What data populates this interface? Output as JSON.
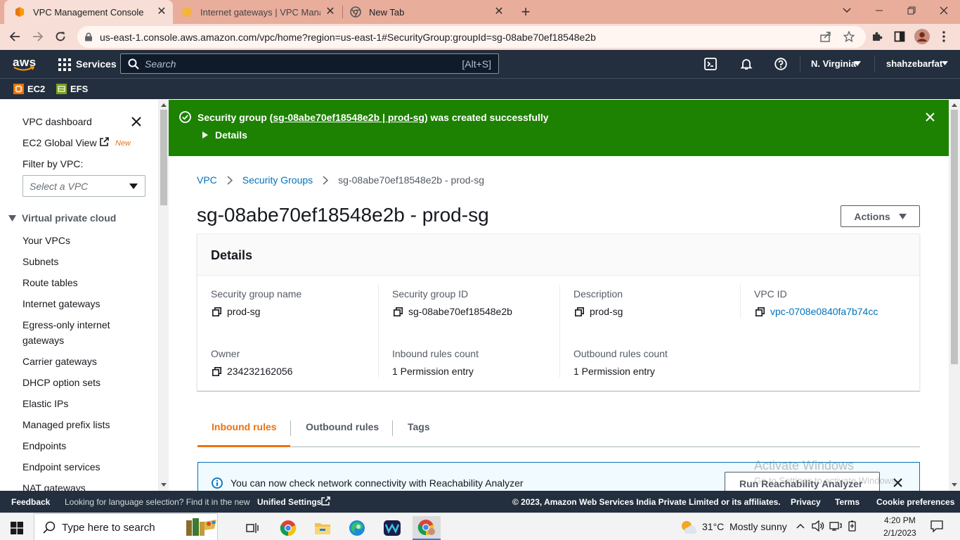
{
  "browser": {
    "tabs": [
      {
        "title": "VPC Management Console",
        "active": true
      },
      {
        "title": "Internet gateways | VPC Managem",
        "active": false
      },
      {
        "title": "New Tab",
        "active": false
      }
    ],
    "url": "us-east-1.console.aws.amazon.com/vpc/home?region=us-east-1#SecurityGroup:groupId=sg-08abe70ef18548e2b"
  },
  "aws_header": {
    "logo": "aws",
    "services_label": "Services",
    "search_placeholder": "Search",
    "search_shortcut": "[Alt+S]",
    "region": "N. Virginia",
    "user": "shahzebarfat",
    "favorites": [
      {
        "label": "EC2",
        "color": "#ed7100"
      },
      {
        "label": "EFS",
        "color": "#7aa116"
      }
    ]
  },
  "sidebar": {
    "top_items": [
      "VPC dashboard",
      "EC2 Global View"
    ],
    "new_badge": "New",
    "filter_label": "Filter by VPC:",
    "filter_placeholder": "Select a VPC",
    "section_title": "Virtual private cloud",
    "items": [
      "Your VPCs",
      "Subnets",
      "Route tables",
      "Internet gateways",
      "Egress-only internet gateways",
      "Carrier gateways",
      "DHCP option sets",
      "Elastic IPs",
      "Managed prefix lists",
      "Endpoints",
      "Endpoint services",
      "NAT gateways"
    ]
  },
  "flash": {
    "prefix": "Security group (",
    "link": "sg-08abe70ef18548e2b | prod-sg",
    "suffix": ") was created successfully",
    "details_label": "Details",
    "color": "#1d8102"
  },
  "breadcrumb": [
    "VPC",
    "Security Groups",
    "sg-08abe70ef18548e2b - prod-sg"
  ],
  "page": {
    "title": "sg-08abe70ef18548e2b - prod-sg",
    "actions_label": "Actions"
  },
  "details": {
    "header": "Details",
    "fields": [
      {
        "label": "Security group name",
        "value": "prod-sg"
      },
      {
        "label": "Security group ID",
        "value": "sg-08abe70ef18548e2b"
      },
      {
        "label": "Description",
        "value": "prod-sg"
      },
      {
        "label": "VPC ID",
        "value": "vpc-0708e0840fa7b74cc"
      },
      {
        "label": "Owner",
        "value": "234232162056"
      },
      {
        "label": "Inbound rules count",
        "value": "1 Permission entry"
      },
      {
        "label": "Outbound rules count",
        "value": "1 Permission entry"
      }
    ]
  },
  "tabs": [
    "Inbound rules",
    "Outbound rules",
    "Tags"
  ],
  "info_banner": {
    "text": "You can now check network connectivity with Reachability Analyzer",
    "button": "Run Reachability Analyzer"
  },
  "watermark": {
    "line1": "Activate Windows",
    "line2": "Go to Settings to activate Windows."
  },
  "footer": {
    "feedback": "Feedback",
    "language_prompt": "Looking for language selection? Find it in the new",
    "unified_settings": "Unified Settings",
    "copyright": "© 2023, Amazon Web Services India Private Limited or its affiliates.",
    "links": [
      "Privacy",
      "Terms",
      "Cookie preferences"
    ]
  },
  "taskbar": {
    "search_placeholder": "Type here to search",
    "weather": "31°C  Mostly sunny",
    "time": "4:20 PM",
    "date": "2/1/2023"
  },
  "colors": {
    "aws_orange": "#ec7211",
    "link": "#0073bb",
    "nav_bg": "#232f3e"
  }
}
